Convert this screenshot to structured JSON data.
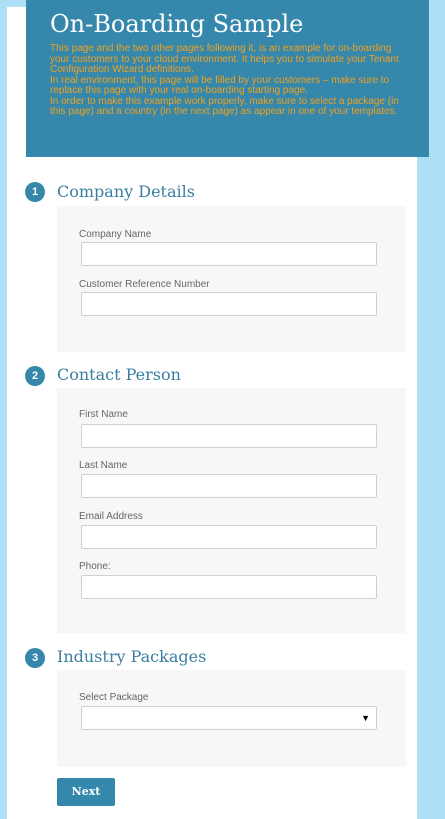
{
  "header": {
    "title": "On-Boarding Sample",
    "description": [
      "This page and the two other pages following it, is an example for on-boarding your customers to your cloud environment. It helps you to simulate your Tenant Configuration Wizard definitions.",
      "In real environment, this page will be filled by your customers – make sure to replace this page with your real on-boarding starting page.",
      "In order to make this example work properly, make sure to select a package (in this page) and a country (in the next page) as appear in one of your templates."
    ]
  },
  "sections": {
    "company": {
      "num": "1",
      "title": "Company Details",
      "fields": [
        "Company Name",
        "Customer Reference Number"
      ]
    },
    "contact": {
      "num": "2",
      "title": "Contact Person",
      "fields": [
        "First Name",
        "Last Name",
        "Email Address",
        "Phone:"
      ]
    },
    "industry": {
      "num": "3",
      "title": "Industry Packages",
      "select_label": "Select Package",
      "select_value": ""
    }
  },
  "next_label": "Next",
  "icons": {
    "dropdown": "chevron-down-icon"
  },
  "colors": {
    "accent": "#3588ab",
    "header_text": "#f1a020",
    "background": "#ade0f7"
  }
}
